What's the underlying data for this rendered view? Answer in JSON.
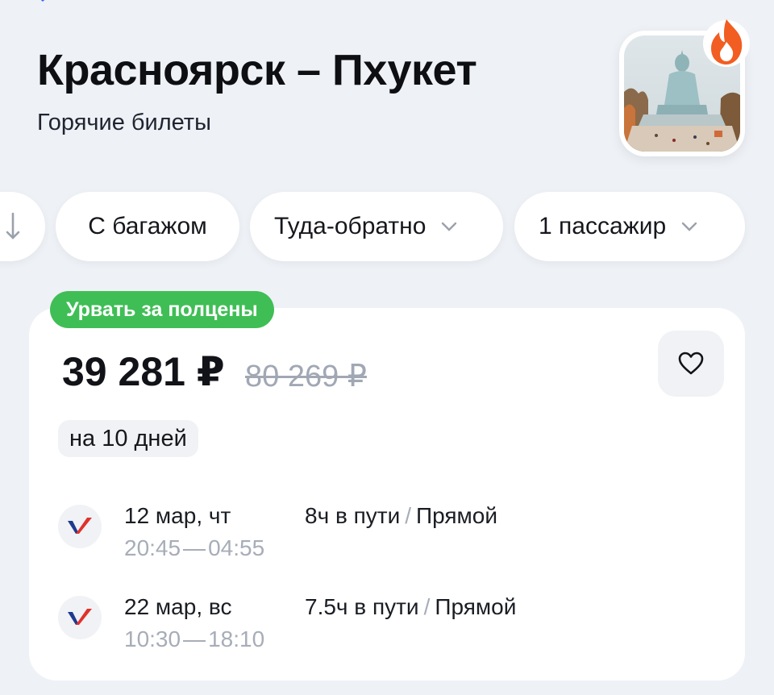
{
  "header": {
    "title": "Красноярск – Пхукет",
    "subtitle": "Горячие билеты"
  },
  "filters": {
    "sort_icon": "arrow-down-icon",
    "baggage": "С багажом",
    "trip_type": "Туда-обратно",
    "passengers": "1 пассажир"
  },
  "offer": {
    "badge": "Урвать за полцены",
    "price": "39 281 ₽",
    "old_price": "80 269 ₽",
    "duration": "на 10 дней",
    "favorite_icon": "heart-icon",
    "legs": [
      {
        "date": "12 мар, чт",
        "depart": "20:45",
        "arrive": "04:55",
        "travel_time": "8ч в пути",
        "separator": "/",
        "stops": "Прямой"
      },
      {
        "date": "22 мар, вс",
        "depart": "10:30",
        "arrive": "18:10",
        "travel_time": "7.5ч в пути",
        "separator": "/",
        "stops": "Прямой"
      }
    ]
  },
  "colors": {
    "background": "#eef1f6",
    "promo_green": "#3fbe55",
    "fire_orange": "#f25d22",
    "airline_red": "#e0312b",
    "airline_blue": "#1f3b8f"
  }
}
